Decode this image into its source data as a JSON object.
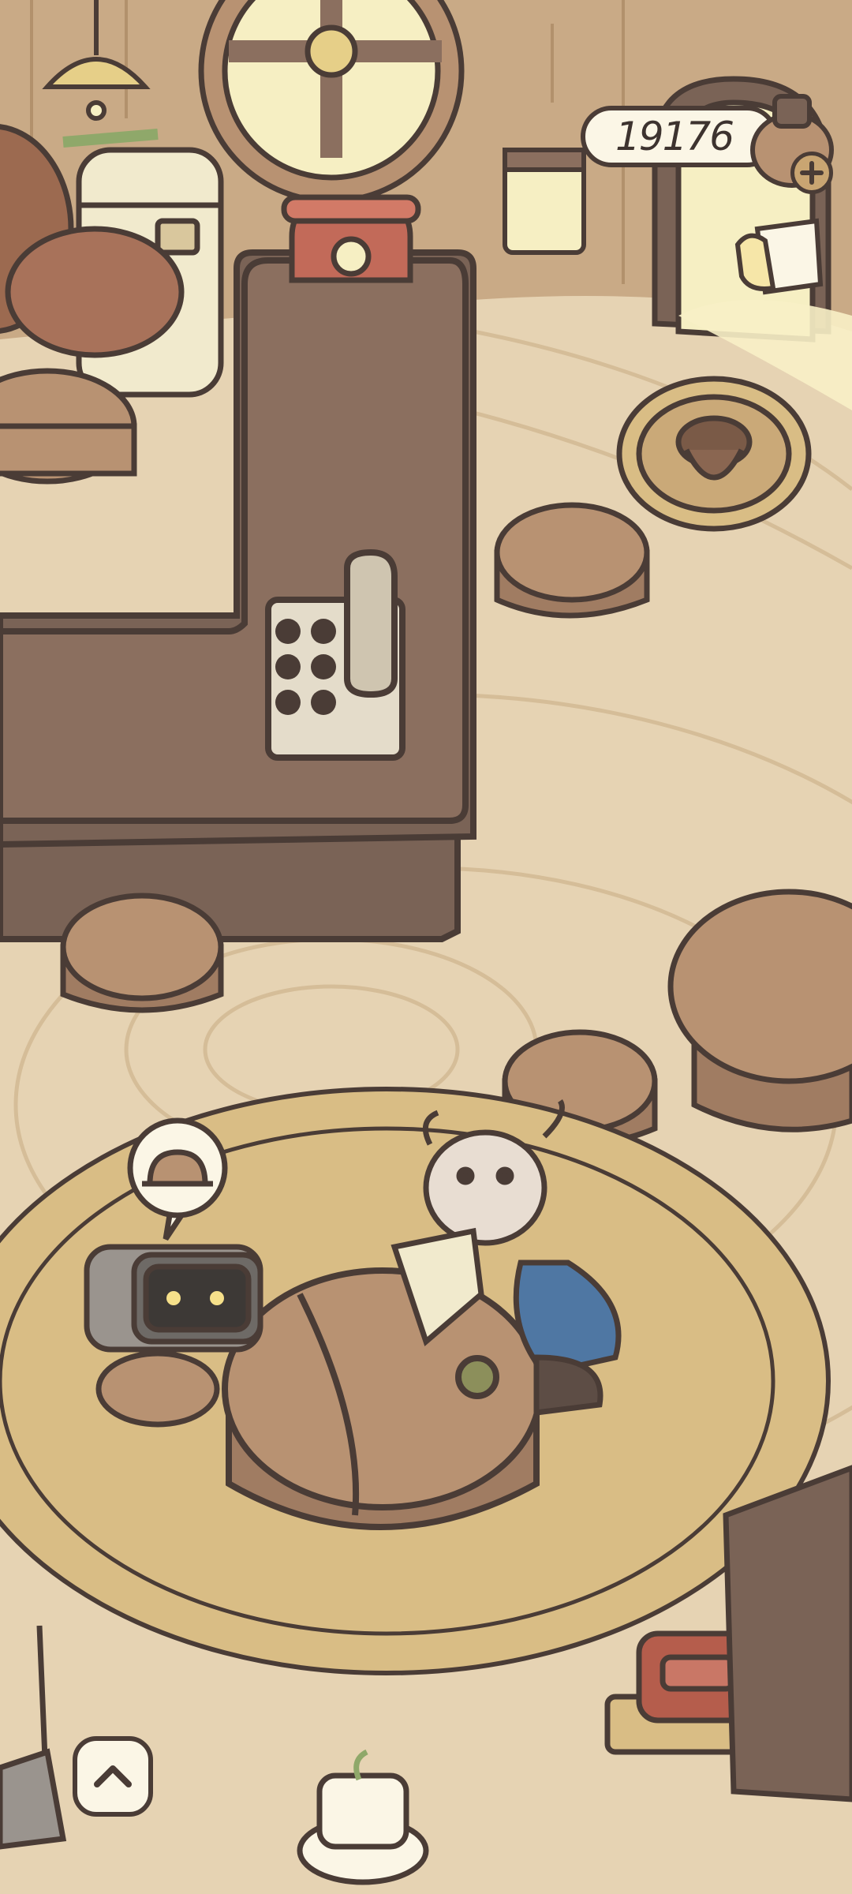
{
  "hud": {
    "coins": "19176",
    "add_coins_icon": "plus-icon",
    "coin_icon": "acorn-pot-icon",
    "order_icon": "order-note-icon",
    "expand_icon": "chevron-up-icon"
  },
  "colors": {
    "floor": "#e6d3b3",
    "wall": "#c9aa86",
    "outline": "#4a3c36",
    "wood_dark": "#7a6356",
    "wood_light": "#b89272",
    "rug": "#d9bd85",
    "cream": "#fbf6e6"
  }
}
